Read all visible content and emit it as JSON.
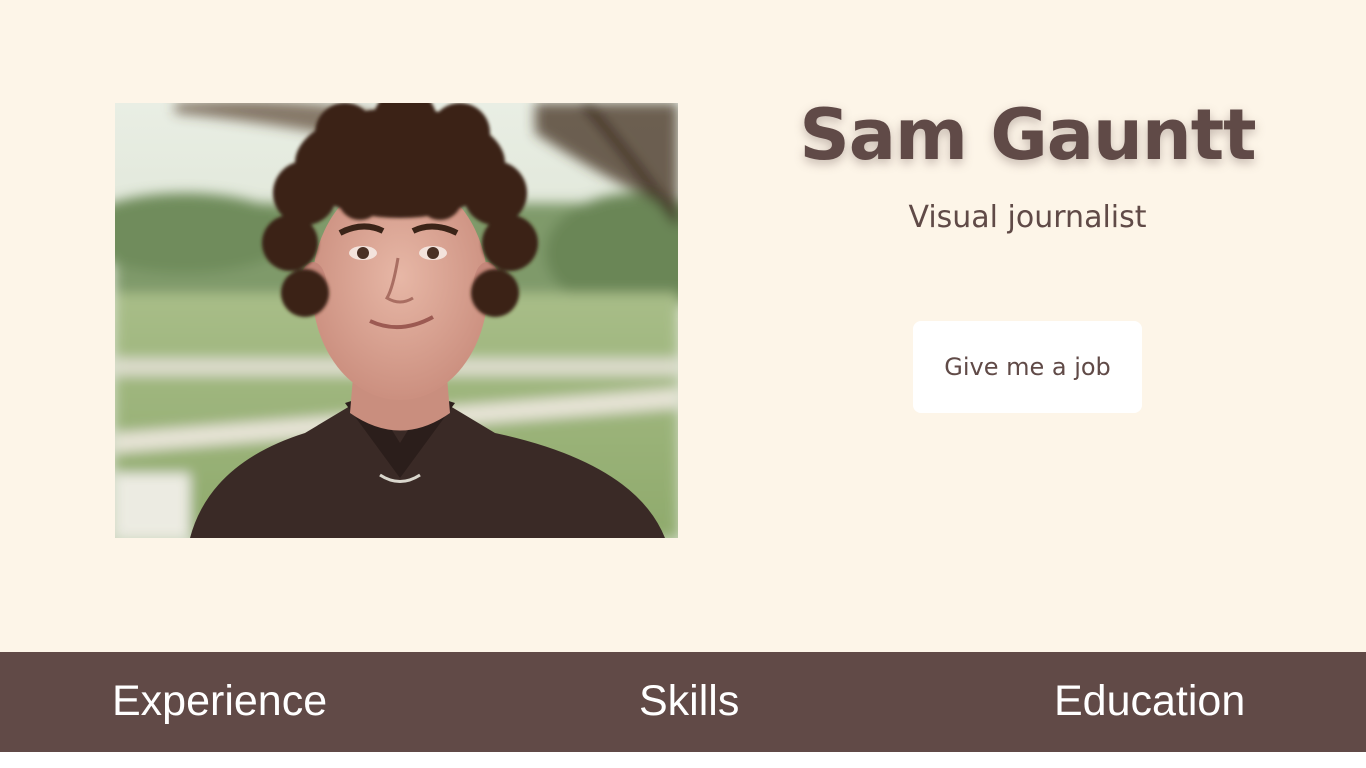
{
  "hero": {
    "name": "Sam Gauntt",
    "subtitle": "Visual journalist",
    "cta_label": "Give me a job",
    "portrait_alt": "Portrait photo"
  },
  "nav": {
    "items": [
      {
        "label": "Experience"
      },
      {
        "label": "Skills"
      },
      {
        "label": "Education"
      }
    ]
  },
  "colors": {
    "background": "#fdf5e8",
    "brand_brown": "#614a47",
    "button_bg": "#ffffff",
    "nav_text": "#ffffff"
  }
}
